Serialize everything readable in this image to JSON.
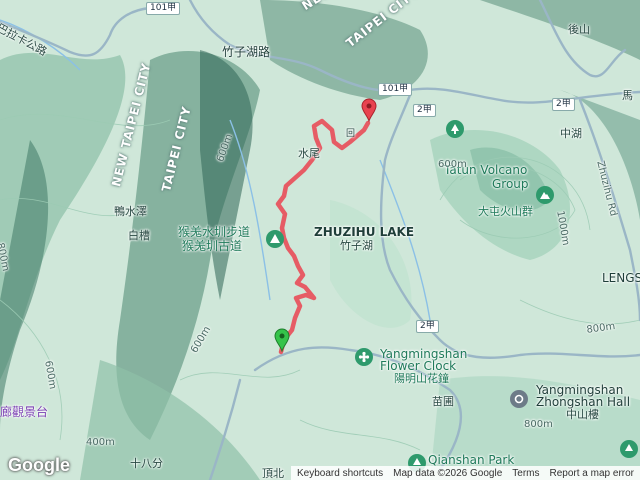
{
  "map": {
    "place_labels": {
      "bala_road": "巴拉卡公路",
      "zhuzihu_road": "竹子湖路",
      "shuiwei": "水尾",
      "yazilize": "鴨水澤",
      "baihu": "白槽",
      "houbi_trail_1": "猴羗水圳步道",
      "houbi_trail_2": "猴羗圳古道",
      "zhuzihu_lake_en": "ZHUZIHU LAKE",
      "zhuzihu_lake_zh": "竹子湖",
      "tatun_en_1": "Tatun Volcano",
      "tatun_en_2": "Group",
      "tatun_zh": "大屯火山群",
      "houshan": "後山",
      "zhonghu": "中湖",
      "zhuzihu_rd": "Zhuzihu Rd",
      "ma": "馬",
      "lengs": "LENGS",
      "flower_clock_en_1": "Yangmingshan",
      "flower_clock_en_2": "Flower Clock",
      "flower_clock_zh": "陽明山花鐘",
      "miaopu": "苗圃",
      "zhongshan_en_1": "Yangmingshan",
      "zhongshan_en_2": "Zhongshan Hall",
      "zhongshan_zh": "中山樓",
      "qianshan": "Qianshan Park",
      "lookout": "廊觀景台",
      "shibafen": "十八分",
      "dingbei": "頂北",
      "hui": "回"
    },
    "cities": {
      "new_taipei_top": "NEW TAIPEI",
      "taipei_top": "TAIPEI CITY",
      "new_taipei_left": "NEW TAIPEI CITY",
      "taipei_left": "TAIPEI CITY"
    },
    "road_shields": {
      "r101_top": "101甲",
      "r101_mid": "101甲",
      "r2_a": "2甲",
      "r2_b": "2甲",
      "r2_c": "2甲"
    },
    "elevations": [
      "800m",
      "600m",
      "400m",
      "600m",
      "1000m",
      "800m",
      "600m",
      "600m",
      "800m"
    ],
    "colors": {
      "track": "#e8505b",
      "start_marker": "#35c44a",
      "end_marker": "#e8434f",
      "poi_green": "#2e9a6c",
      "poi_gray": "#6d7b88"
    }
  },
  "attribution": {
    "logo": "Google",
    "shortcuts": "Keyboard shortcuts",
    "data": "Map data ©2026 Google",
    "terms": "Terms",
    "report": "Report a map error"
  }
}
